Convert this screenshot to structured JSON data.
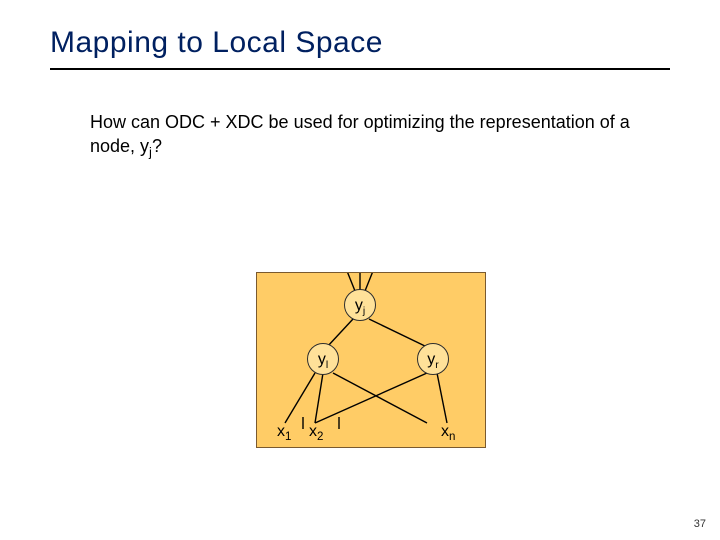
{
  "title": "Mapping to Local Space",
  "question_a": "How can ODC + XDC be used for optimizing the representation of a node, y",
  "question_sub": "j",
  "question_b": "?",
  "nodes": {
    "yj_main": "y",
    "yj_sub": "j",
    "yl_main": "y",
    "yl_sub": "l",
    "yr_main": "y",
    "yr_sub": "r"
  },
  "leaves": {
    "x1_main": "x",
    "x1_sub": "1",
    "x2_main": "x",
    "x2_sub": "2",
    "xn_main": "x",
    "xn_sub": "n"
  },
  "slide_number": "37"
}
